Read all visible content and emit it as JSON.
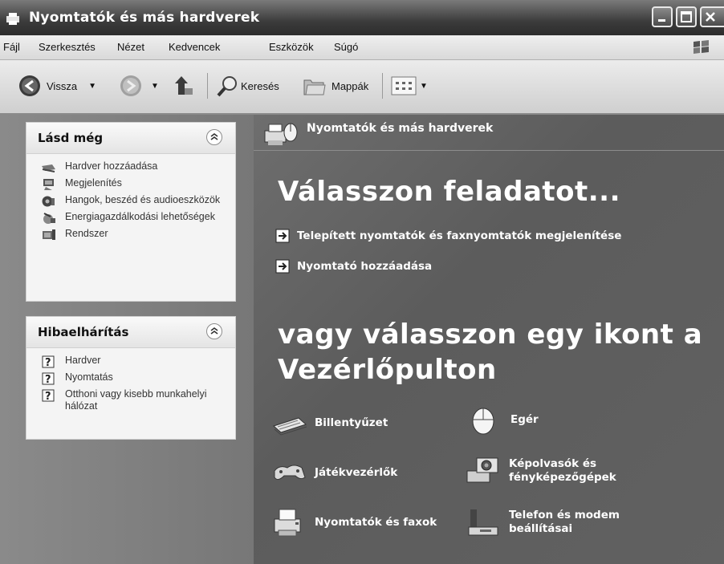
{
  "window": {
    "title": "Nyomtatók és más hardverek"
  },
  "menu": [
    "Fájl",
    "Szerkesztés",
    "Nézet",
    "Kedvencek",
    "Eszközök",
    "Súgó"
  ],
  "toolbar": {
    "back": "Vissza",
    "search": "Keresés",
    "folders": "Mappák"
  },
  "see_also": {
    "title": "Lásd még",
    "items": [
      {
        "label": "Hardver hozzáadása",
        "icon": "add-hardware-icon"
      },
      {
        "label": "Megjelenítés",
        "icon": "display-icon"
      },
      {
        "label": "Hangok, beszéd és audioeszközök",
        "icon": "sound-icon"
      },
      {
        "label": "Energiagazdálkodási lehetőségek",
        "icon": "power-icon"
      },
      {
        "label": "Rendszer",
        "icon": "system-icon"
      }
    ]
  },
  "troubleshoot": {
    "title": "Hibaelhárítás",
    "items": [
      {
        "label": "Hardver",
        "icon": "help-icon"
      },
      {
        "label": "Nyomtatás",
        "icon": "help-icon"
      },
      {
        "label": "Otthoni vagy kisebb munkahelyi hálózat",
        "icon": "help-icon"
      }
    ]
  },
  "main": {
    "header": "Nyomtatók és más hardverek",
    "pick_task": "Válasszon feladatot...",
    "tasks": [
      "Telepített nyomtatók és faxnyomtatók megjelenítése",
      "Nyomtató hozzáadása"
    ],
    "pick_icon": "vagy válasszon egy ikont a Vezérlőpulton",
    "icons": [
      {
        "label": "Billentyűzet",
        "icon": "keyboard-icon"
      },
      {
        "label": "Egér",
        "icon": "mouse-icon"
      },
      {
        "label": "Játékvezérlők",
        "icon": "gamepad-icon"
      },
      {
        "label": "Képolvasók és fényképezőgépek",
        "icon": "scanner-camera-icon"
      },
      {
        "label": "Nyomtatók és faxok",
        "icon": "printer-fax-icon"
      },
      {
        "label": "Telefon és modem beállításai",
        "icon": "phone-modem-icon"
      }
    ]
  }
}
